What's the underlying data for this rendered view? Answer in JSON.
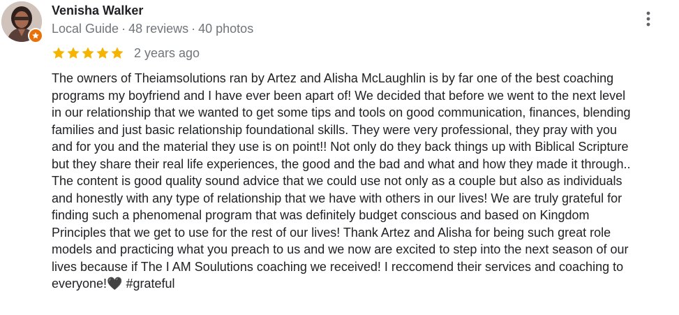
{
  "reviewer": {
    "name": "Venisha Walker",
    "badge": "Local Guide",
    "reviews": "48 reviews",
    "photos": "40 photos",
    "separator": "·"
  },
  "rating": {
    "stars": 5,
    "max_stars": 5,
    "star_color": "#f4b400",
    "date": "2 years ago"
  },
  "icons": {
    "avatar": "profile-photo",
    "badge": "local-guide-star-icon",
    "menu": "more-vert-icon",
    "star": "star-icon"
  },
  "colors": {
    "badge_orange": "#e8710a",
    "meta_gray": "#70757a",
    "text": "#202124"
  },
  "review": {
    "text": "The owners of Theiamsolutions ran by Artez and Alisha McLaughlin is by far one of the best coaching\nprograms my boyfriend and I have ever been apart of! We decided that before we went to the next level\nin our relationship that we wanted to get some tips and tools on good communication, finances, blending\nfamilies and just basic relationship foundational skills. They were very professional, they pray with you\nand for you and the material they use is on point!! Not only do they back things up with Biblical Scripture\nbut they share their real life experiences, the good and the bad and what and how they made it through..\nThe content is good quality sound advice that we could use not only as a couple but also as individuals\nand honestly with any type of relationship that we have with others in our lives! We are truly grateful for\nfinding such a phenomenal program that was definitely budget conscious and based on Kingdom\nPrinciples that we get to use for the rest of our lives! Thank Artez and Alisha for being such great role\nmodels and practicing what you preach to us and we now are excited to step into the next season of our\nlives because if The I AM Soulutions coaching we received! I reccomend their services and coaching to\neveryone!🖤 #grateful"
  }
}
